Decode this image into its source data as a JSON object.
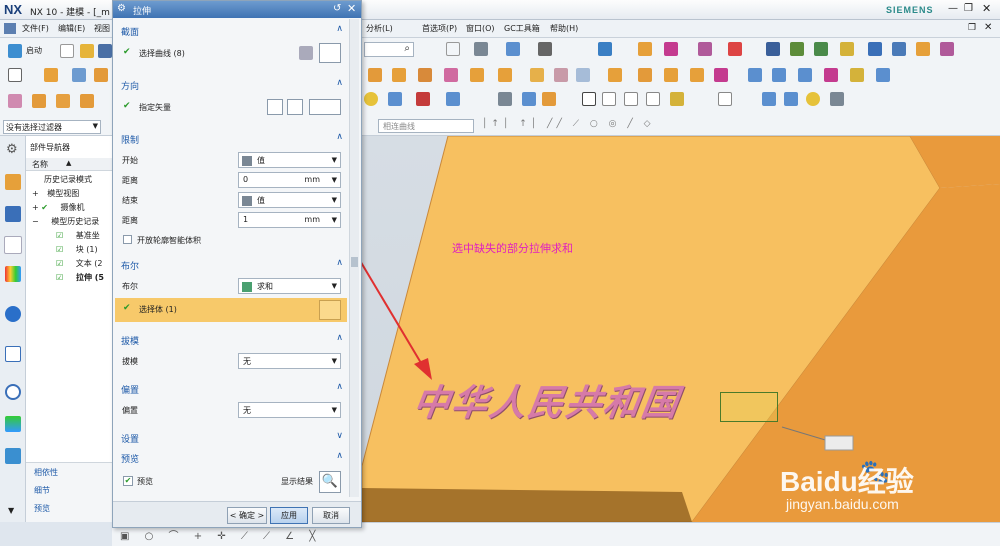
{
  "app": {
    "logo": "NX",
    "title": "NX 10 - 建模 - [_m",
    "brand": "SIEMENS"
  },
  "menubar": {
    "left_items": [
      "文件(F)",
      "编辑(E)",
      "视图"
    ],
    "right_items": [
      "首选项(P)",
      "窗口(O)",
      "GC工具箱",
      "帮助(H)"
    ],
    "analysis": "分析(L)"
  },
  "toolbar": {
    "start_label": "启动",
    "filter_label": "没有选择过滤器",
    "curve_rule": "相连曲线",
    "search_placeholder": ""
  },
  "navigator": {
    "title": "部件导航器",
    "column_name": "名称",
    "items": [
      {
        "label": "历史记录模式"
      },
      {
        "label": "模型视图"
      },
      {
        "label": "摄像机"
      },
      {
        "label": "模型历史记录"
      },
      {
        "label": "基准坐"
      },
      {
        "label": "块 (1)"
      },
      {
        "label": "文本 (2"
      },
      {
        "label": "拉伸 (5"
      }
    ],
    "footer": [
      "相依性",
      "细节",
      "预览"
    ]
  },
  "dialog": {
    "title": "拉伸",
    "sections": {
      "section": "截面",
      "direction": "方向",
      "limits": "限制",
      "boolean": "布尔",
      "draft": "拔模",
      "offset": "偏置",
      "settings": "设置",
      "preview": "预览"
    },
    "select_curve": "选择曲线 (8)",
    "specify_vector": "指定矢量",
    "start_label": "开始",
    "start_value": "值",
    "distance1_label": "距离",
    "distance1_value": "0",
    "distance1_unit": "mm",
    "end_label": "结束",
    "end_value": "值",
    "distance2_label": "距离",
    "distance2_value": "1",
    "distance2_unit": "mm",
    "open_profile": "开放轮廓智能体积",
    "boolean_label": "布尔",
    "boolean_value": "求和",
    "select_body": "选择体 (1)",
    "draft_label": "拔模",
    "draft_value": "无",
    "offset_label": "偏置",
    "offset_value": "无",
    "preview_check": "预览",
    "show_result": "显示结果",
    "ok": "< 确定 >",
    "apply": "应用",
    "cancel": "取消"
  },
  "viewport": {
    "annotation": "选中缺失的部分拉伸求和",
    "model_text": "中华人民共和国",
    "watermark_brand": "Baidu经验",
    "watermark_url": "jingyan.baidu.com"
  },
  "colors": {
    "accent": "#1e5aa8",
    "block_top": "#f7c060",
    "block_side": "#e99a3c",
    "annotation": "#e020c0",
    "arrow": "#e03030"
  }
}
